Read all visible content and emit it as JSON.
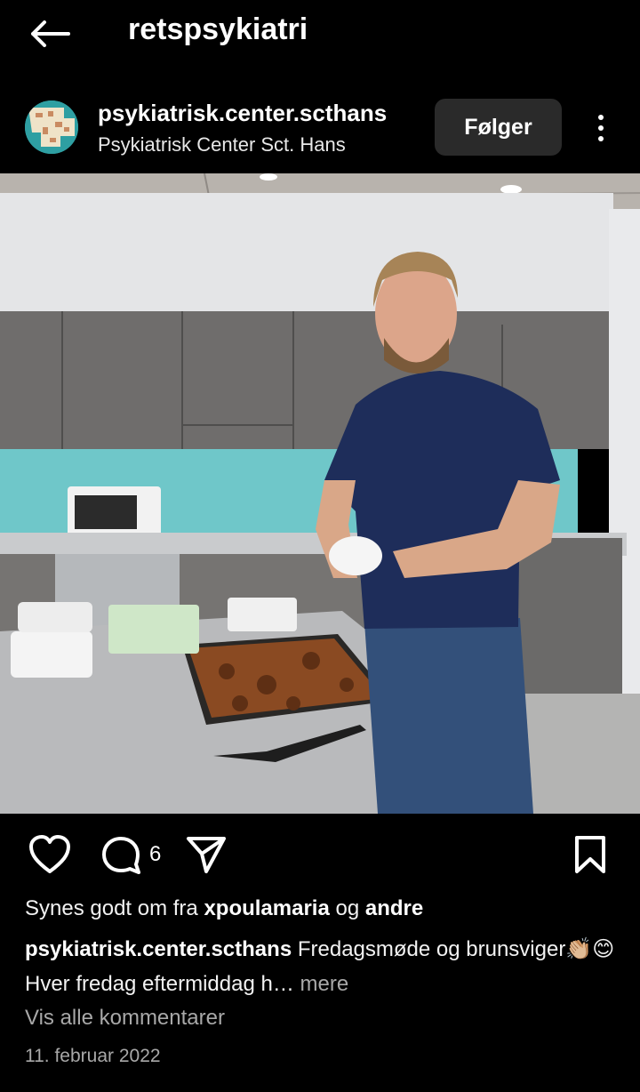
{
  "header": {
    "title": "retspsykiatri"
  },
  "post": {
    "username": "psykiatrisk.center.scthans",
    "full_name": "Psykiatrisk Center Sct. Hans",
    "follow_label": "Følger",
    "comment_count": "6",
    "likes": {
      "prefix": "Synes godt om fra",
      "user": "xpoulamaria",
      "joiner": "og",
      "others": "andre"
    },
    "caption": {
      "author": "psykiatrisk.center.scthans",
      "text": " Fredagsmøde og brunsviger👏🏼😊 Hver fredag eftermiddag h… ",
      "more": "mere"
    },
    "view_comments": "Vis alle kommentarer",
    "date": "11. februar 2022"
  },
  "colors": {
    "background": "#000000",
    "follow_button": "#2a2a2a",
    "secondary_text": "#a8a8a8",
    "backsplash": "#6fc7c9"
  },
  "icons": [
    "back-arrow-icon",
    "more-options-icon",
    "heart-icon",
    "comment-icon",
    "share-icon",
    "bookmark-icon"
  ]
}
